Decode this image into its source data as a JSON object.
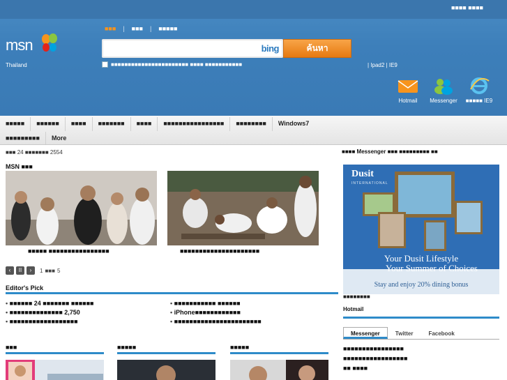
{
  "header": {
    "top_links": "■■■■ ■■■■",
    "logo": "msn",
    "country": "Thailand",
    "search_tabs": [
      {
        "label": "■■■",
        "active": true
      },
      {
        "label": "■■■",
        "active": false
      },
      {
        "label": "■■■■■",
        "active": false
      }
    ],
    "search_placeholder": "",
    "bing_label": "bing",
    "search_button": "ค้นหา",
    "search_options": "■■■■■■■■■■■■■■■■■■■■■■■ ■■■■ ■■■■■■■■■■■",
    "quick_links": "| Ipad2 | IE9",
    "apps": [
      {
        "label": "Hotmail",
        "icon": "envelope-icon"
      },
      {
        "label": "Messenger",
        "icon": "messenger-people-icon"
      },
      {
        "label": "■■■■■ IE9",
        "icon": "ie-logo-icon"
      }
    ]
  },
  "nav": {
    "row1": [
      "■■■■■",
      "■■■■■■",
      "■■■■",
      "■■■■■■■",
      "■■■■",
      "■■■■■■■■■■■■■■■■",
      "■■■■■■■■",
      "Windows7"
    ],
    "row2": [
      "■■■■■■■■■",
      "More"
    ]
  },
  "main": {
    "date_line": "■■■ 24 ■■■■■■■ 2554",
    "section_title": "MSN ■■■",
    "caption_left": "■■■■■ ■■■■■■■■■■■■■■■■",
    "caption_right": "■■■■■■■■■■■■■■■■■■■■■",
    "pager": {
      "prev": "‹",
      "pause": "II",
      "next": "›",
      "from": "1",
      "to": "5"
    },
    "editors_pick": "Editor's Pick",
    "picks_left": [
      "■■■■■■ 24 ■■■■■■■ ■■■■■■",
      "■■■■■■■■■■■■■■ 2,750",
      "■■■■■■■■■■■■■■■■■■"
    ],
    "picks_right": [
      "■■■■■■■■■■■ ■■■■■■",
      "iPhone■■■■■■■■■■■■",
      "■■■■■■■■■■■■■■■■■■■■■■■"
    ],
    "sub_sections": [
      "■■■",
      "■■■■■",
      "■■■■■"
    ]
  },
  "right": {
    "head": "■■■■ Messenger ■■■ ■■■■■■■■■ ■■",
    "ad": {
      "brand": "Dusit",
      "brand_sub": "INTERNATIONAL",
      "line1": "Your Dusit Lifestyle",
      "line2": "Your Summer of Choices",
      "line3": "Stay and enjoy 20% dining bonus"
    },
    "ad_dots": "■■■■■■■■",
    "hotmail_heading": "Hotmail",
    "tabs": [
      "Messenger",
      "Twitter",
      "Facebook"
    ],
    "tab_body": [
      "■■■■■■■■■■■■■■■■",
      "■■■■■■■■■■■■■■■■■",
      "■■ ■■■■"
    ]
  },
  "colors": {
    "header_blue": "#3d7fba",
    "accent_orange": "#f7941d",
    "rule_blue": "#2e8bc9"
  }
}
